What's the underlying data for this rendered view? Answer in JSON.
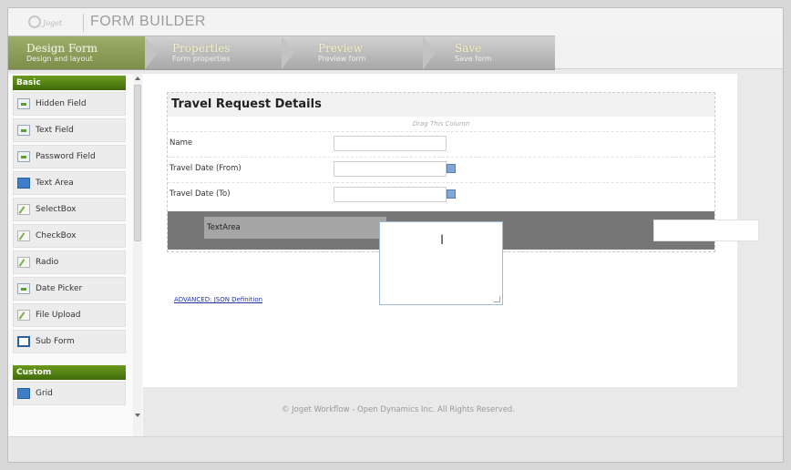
{
  "header": {
    "logo_text": "Joget",
    "title": "FORM BUILDER"
  },
  "steps": [
    {
      "title": "Design Form",
      "subtitle": "Design and layout"
    },
    {
      "title": "Properties",
      "subtitle": "Form properties"
    },
    {
      "title": "Preview",
      "subtitle": "Preview form"
    },
    {
      "title": "Save",
      "subtitle": "Save form"
    }
  ],
  "palette": {
    "basic_label": "Basic",
    "basic_items": [
      {
        "label": "Hidden Field",
        "icon": "hidden-field-icon"
      },
      {
        "label": "Text Field",
        "icon": "text-field-icon"
      },
      {
        "label": "Password Field",
        "icon": "password-field-icon"
      },
      {
        "label": "Text Area",
        "icon": "text-area-icon"
      },
      {
        "label": "SelectBox",
        "icon": "selectbox-icon"
      },
      {
        "label": "CheckBox",
        "icon": "checkbox-icon"
      },
      {
        "label": "Radio",
        "icon": "radio-icon"
      },
      {
        "label": "Date Picker",
        "icon": "date-picker-icon"
      },
      {
        "label": "File Upload",
        "icon": "file-upload-icon"
      },
      {
        "label": "Sub Form",
        "icon": "sub-form-icon"
      }
    ],
    "custom_label": "Custom",
    "custom_items": [
      {
        "label": "Grid",
        "icon": "grid-icon"
      }
    ]
  },
  "form": {
    "title": "Travel Request Details",
    "drag_note": "Drag This Column",
    "fields": [
      {
        "label": "Name"
      },
      {
        "label": "Travel Date (From)"
      },
      {
        "label": "Travel Date (To)"
      }
    ],
    "textarea_label": "TextArea"
  },
  "advanced_link": "ADVANCED: JSON Definition",
  "footer": "© Joget Workflow - Open Dynamics Inc. All Rights Reserved."
}
